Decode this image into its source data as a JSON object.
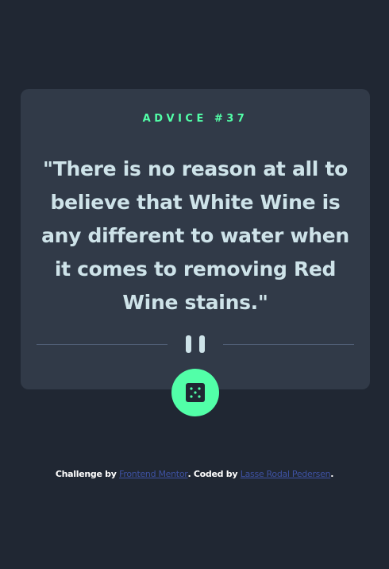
{
  "card": {
    "advice_label": "ADVICE #37",
    "quote": "\"There is no reason at all to believe that White Wine is any different to water when it comes to removing Red Wine stains.\""
  },
  "dice_button": {
    "icon": "dice-icon"
  },
  "attribution": {
    "prefix": "Challenge by",
    "frontend_mentor_link": "Frontend Mentor",
    "middle": ". Coded by",
    "author_link": "Lasse Rodal Pedersen",
    "suffix": "."
  },
  "colors": {
    "background": "#202733",
    "card": "#313a48",
    "accent": "#52ffa8",
    "quote_text": "#cee3e9",
    "divider": "#4f5d74",
    "link": "#3e52a3"
  }
}
